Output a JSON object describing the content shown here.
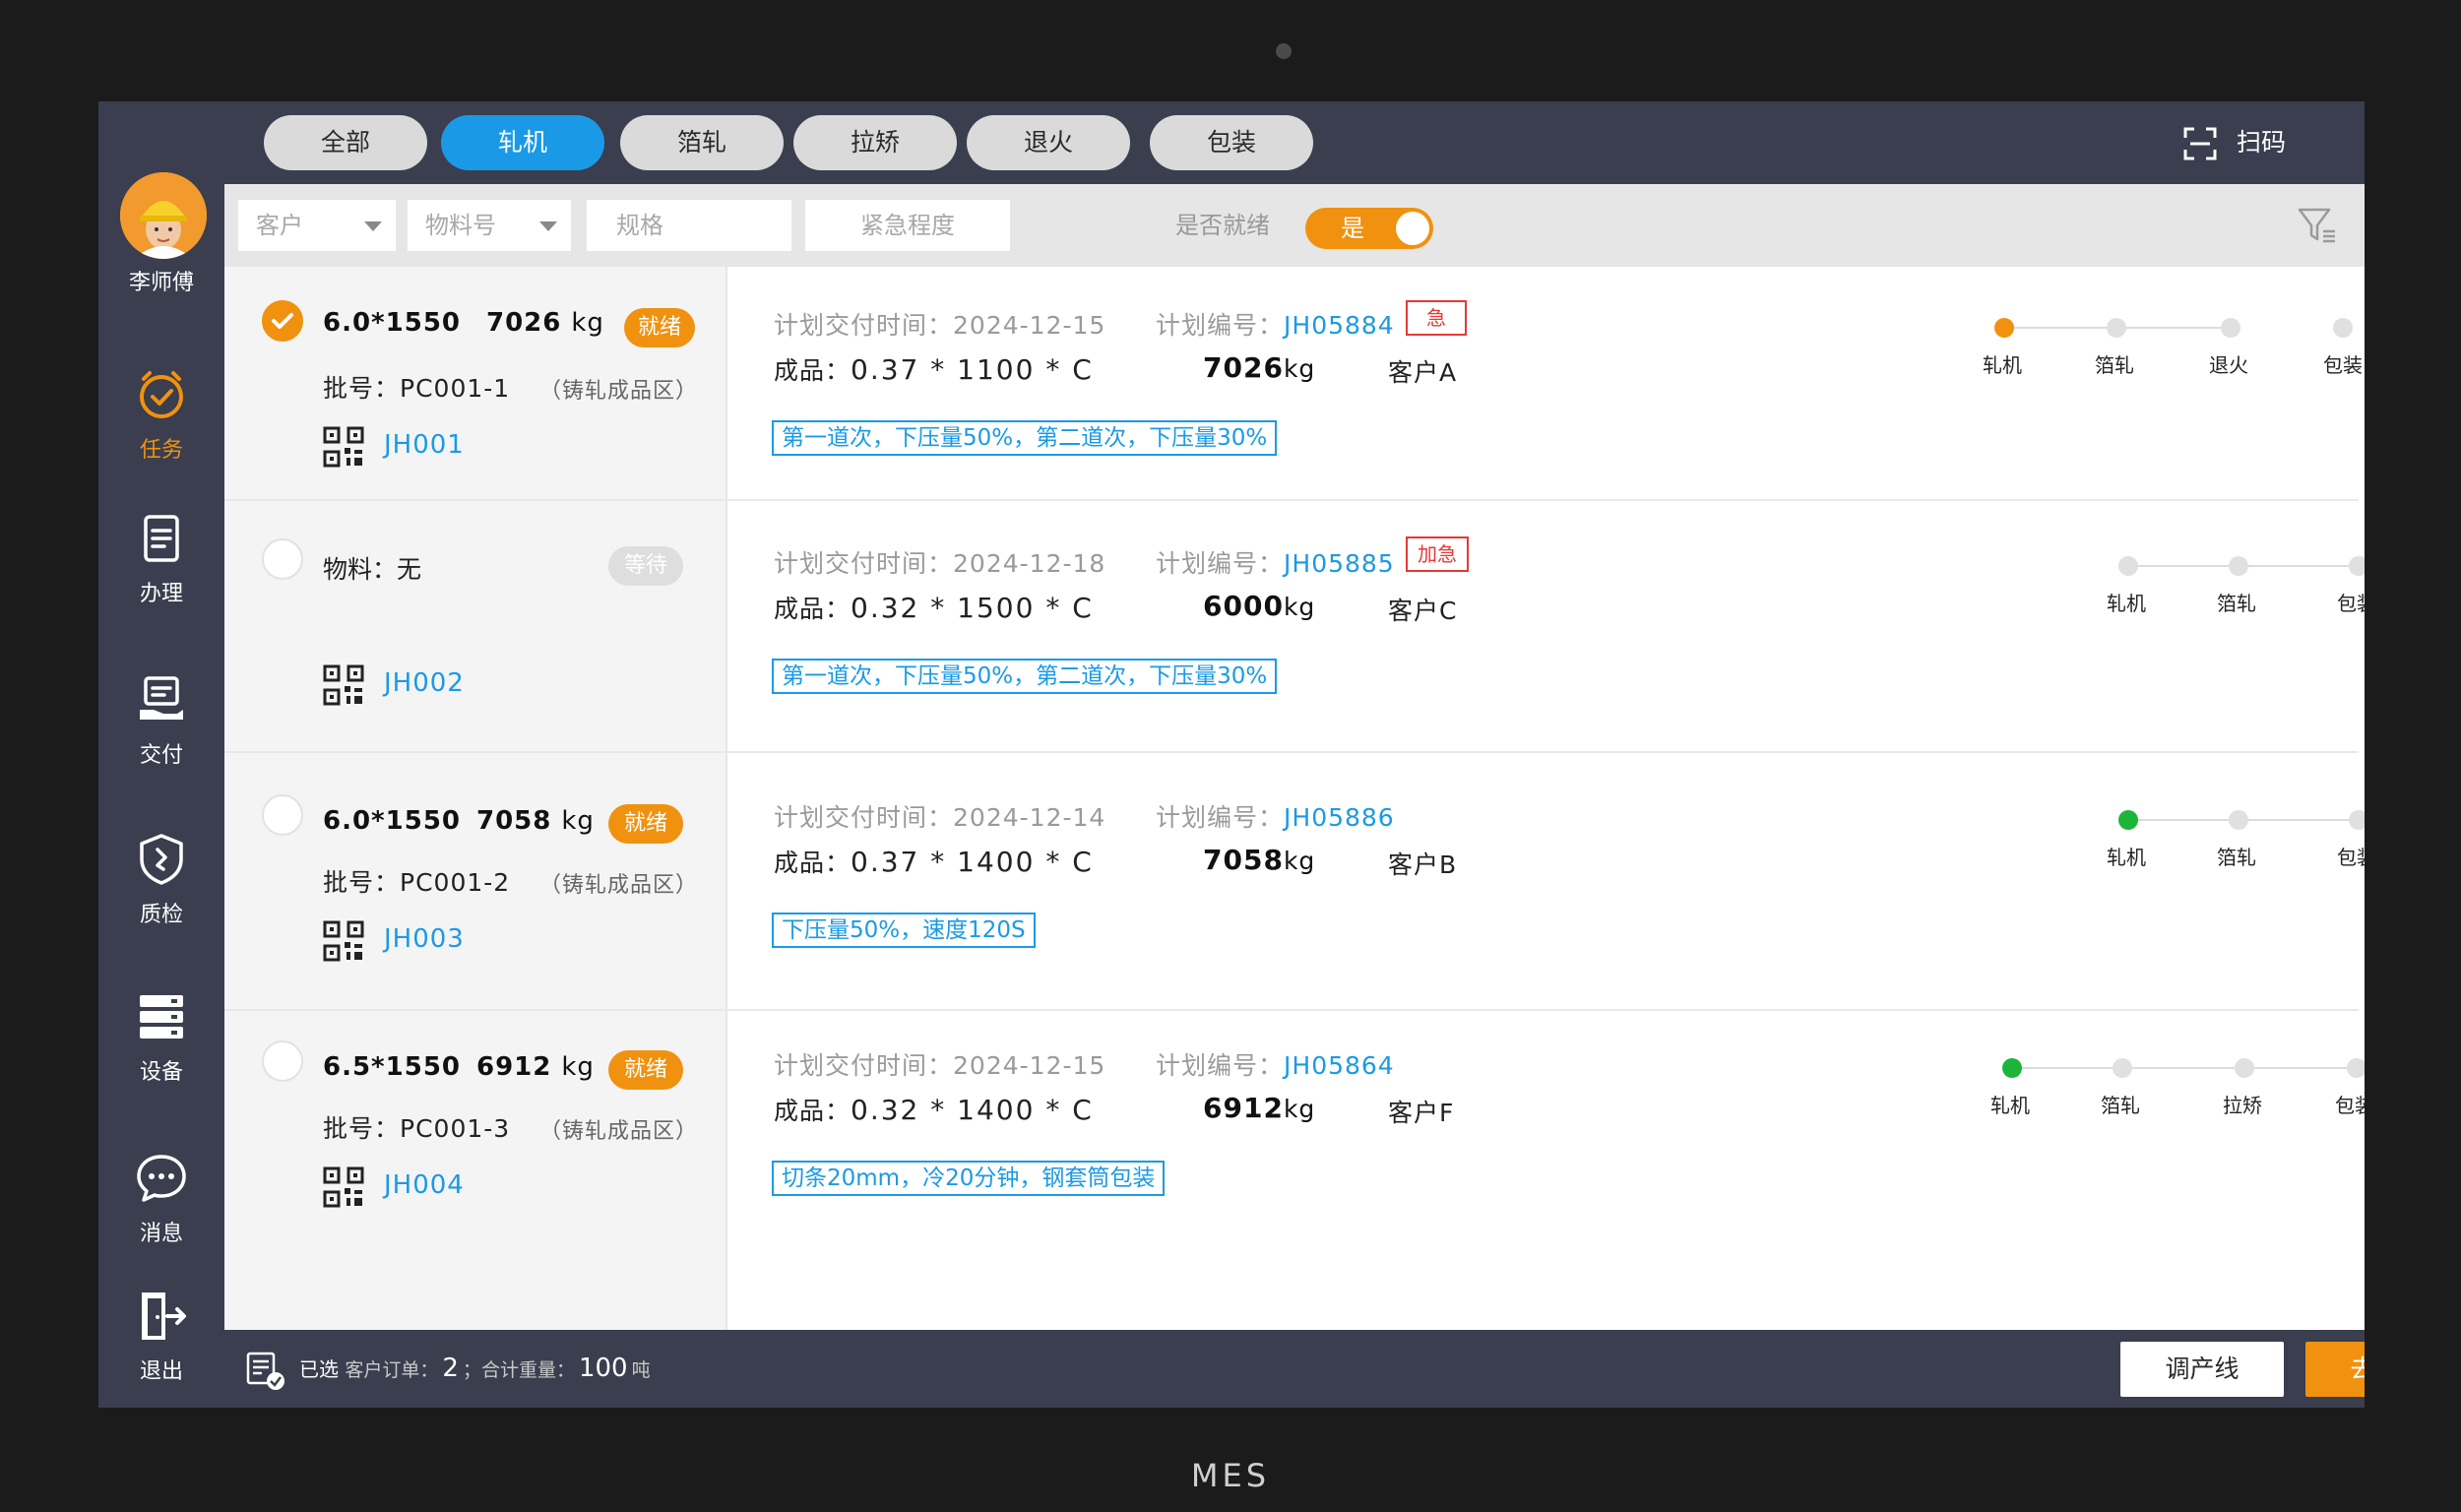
{
  "device_label": "MES",
  "sidebar": {
    "user_name": "李师傅",
    "items": [
      {
        "label": "任务",
        "icon": "clock-check-icon"
      },
      {
        "label": "办理",
        "icon": "document-icon"
      },
      {
        "label": "交付",
        "icon": "delivery-hand-icon"
      },
      {
        "label": "质检",
        "icon": "shield-icon"
      },
      {
        "label": "设备",
        "icon": "server-icon"
      },
      {
        "label": "消息",
        "icon": "chat-bubble-icon"
      },
      {
        "label": "退出",
        "icon": "exit-icon"
      }
    ]
  },
  "tabs": [
    {
      "label": "全部"
    },
    {
      "label": "轧机"
    },
    {
      "label": "箔轧"
    },
    {
      "label": "拉矫"
    },
    {
      "label": "退火"
    },
    {
      "label": "包装"
    }
  ],
  "scan_label": "扫码",
  "filters": {
    "customer_placeholder": "客户",
    "material_placeholder": "物料号",
    "spec_placeholder": "规格",
    "urgency_placeholder": "紧急程度",
    "ready_label": "是否就绪",
    "ready_value": "是"
  },
  "cards": [
    {
      "checked": true,
      "spec": "6.0*1550",
      "weight_num": "7026",
      "weight_unit": "kg",
      "badge": "就绪",
      "batch": "批号：PC001-1",
      "zone": "（铸轧成品区）",
      "code": "JH001",
      "delivery_label": "计划交付时间：",
      "delivery_date": "2024-12-15",
      "plan_label": "计划编号：",
      "plan_code": "JH05884",
      "urgent": "急",
      "product_label": "成品：",
      "product_dims": "0.37 * 1100 * C",
      "product_weight": "7026",
      "product_weight_unit": "kg",
      "customer": "客户A",
      "note": "第一道次，下压量50%，第二道次，下压量30%",
      "steps": [
        "轧机",
        "箔轧",
        "退火",
        "包装"
      ],
      "current_step": 0
    },
    {
      "checked": false,
      "material": "物料：无",
      "badge": "等待",
      "code": "JH002",
      "delivery_label": "计划交付时间：",
      "delivery_date": "2024-12-18",
      "plan_label": "计划编号：",
      "plan_code": "JH05885",
      "urgent": "加急",
      "product_label": "成品：",
      "product_dims": "0.32 * 1500 * C",
      "product_weight": "6000",
      "product_weight_unit": "kg",
      "customer": "客户C",
      "note": "第一道次，下压量50%，第二道次，下压量30%",
      "steps": [
        "轧机",
        "箔轧",
        "包装"
      ]
    },
    {
      "checked": false,
      "spec": "6.0*1550",
      "weight_num": "7058",
      "weight_unit": "kg",
      "badge": "就绪",
      "batch": "批号：PC001-2",
      "zone": "（铸轧成品区）",
      "code": "JH003",
      "delivery_label": "计划交付时间：",
      "delivery_date": "2024-12-14",
      "plan_label": "计划编号：",
      "plan_code": "JH05886",
      "product_label": "成品：",
      "product_dims": "0.37 * 1400 * C",
      "product_weight": "7058",
      "product_weight_unit": "kg",
      "customer": "客户B",
      "note": "下压量50%，速度120S",
      "steps": [
        "轧机",
        "箔轧",
        "包装"
      ],
      "current_step": 0
    },
    {
      "checked": false,
      "spec": "6.5*1550",
      "weight_num": "6912",
      "weight_unit": "kg",
      "badge": "就绪",
      "batch": "批号：PC001-3",
      "zone": "（铸轧成品区）",
      "code": "JH004",
      "delivery_label": "计划交付时间：",
      "delivery_date": "2024-12-15",
      "plan_label": "计划编号：",
      "plan_code": "JH05864",
      "product_label": "成品：",
      "product_dims": "0.32 * 1400 * C",
      "product_weight": "6912",
      "product_weight_unit": "kg",
      "customer": "客户F",
      "note": "切条20mm，冷20分钟，钢套筒包装",
      "steps": [
        "轧机",
        "箔轧",
        "拉矫",
        "包装"
      ],
      "current_step": 0
    }
  ],
  "footer": {
    "selected_label": "已选",
    "orders_label": "客户订单：",
    "orders_count": "2",
    "sep": "；",
    "total_label": "合计重量：",
    "total_weight": "100",
    "total_unit": "吨",
    "btn_adjust": "调产线",
    "btn_go": "去办理"
  },
  "colors": {
    "accent_orange": "#f0920f",
    "accent_blue": "#1a9ae6",
    "urgent_red": "#e53935",
    "progress_green": "#1db43a",
    "dark_bar": "#3a3e4e"
  }
}
